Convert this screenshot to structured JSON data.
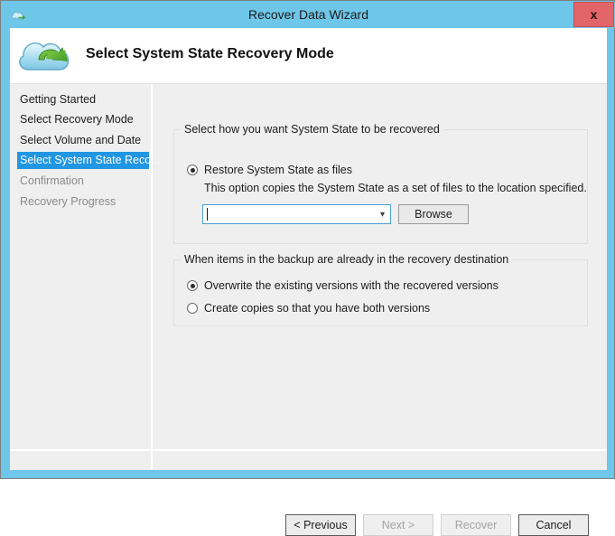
{
  "window": {
    "title": "Recover Data Wizard",
    "app_icon": "cloud-icon",
    "close_label": "x",
    "accent_color": "#6ec6e8",
    "close_color": "#e2656a"
  },
  "header": {
    "icon": "cloud-recovery-icon",
    "title": "Select System State Recovery Mode"
  },
  "sidebar": {
    "items": [
      {
        "label": "Getting Started",
        "state": "normal"
      },
      {
        "label": "Select Recovery Mode",
        "state": "normal"
      },
      {
        "label": "Select Volume and Date",
        "state": "normal"
      },
      {
        "label": "Select System State Reco...",
        "state": "selected"
      },
      {
        "label": "Confirmation",
        "state": "dim"
      },
      {
        "label": "Recovery Progress",
        "state": "dim"
      }
    ],
    "selected_color": "#2196e3"
  },
  "recovery_group": {
    "legend": "Select how you want System State to be recovered",
    "option_label": "Restore System State as files",
    "option_checked": true,
    "helper_text": "This option copies the System State as a set of files to the location specified.",
    "path_value": "",
    "path_placeholder": "",
    "browse_label": "Browse"
  },
  "conflict_group": {
    "legend": "When items in the backup are already in the recovery destination",
    "options": [
      {
        "label": "Overwrite the existing versions with the recovered versions",
        "checked": true
      },
      {
        "label": "Create copies so that you have both versions",
        "checked": false
      }
    ]
  },
  "footer": {
    "previous_label": "< Previous",
    "next_label": "Next >",
    "recover_label": "Recover",
    "cancel_label": "Cancel",
    "next_enabled": false,
    "recover_enabled": false
  }
}
